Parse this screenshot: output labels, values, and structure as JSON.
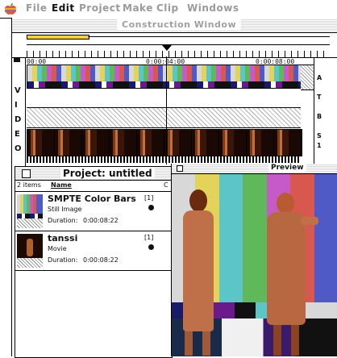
{
  "menu": {
    "items": [
      "File",
      "Edit",
      "Project",
      "Make",
      "Clip",
      "Windows"
    ]
  },
  "construction": {
    "title": "Construction Window",
    "timecodes": [
      "00:00",
      "0:00:04:00",
      "0:00:08:00"
    ],
    "video_letters": [
      "V",
      "I",
      "D",
      "E",
      "O"
    ],
    "track_labels": [
      "A",
      "T",
      "B",
      "S",
      "1"
    ]
  },
  "project": {
    "title": "Project: untitled",
    "items_count": "2 items",
    "col_name": "Name",
    "col_c": "C",
    "items": [
      {
        "name": "SMPTE Color Bars",
        "kind": "Still Image",
        "duration_label": "Duration:",
        "duration": "0:00:08:22",
        "count": "[1]"
      },
      {
        "name": "tanssi",
        "kind": "Movie",
        "duration_label": "Duration:",
        "duration": "0:00:08:22",
        "count": "[1]"
      }
    ]
  },
  "preview": {
    "title": "Preview"
  },
  "colors": {
    "bars": [
      "#d8d8d8",
      "#e3d35a",
      "#5cc6c6",
      "#5fb85a",
      "#c65ac6",
      "#d8584f",
      "#4f5ac6"
    ]
  }
}
